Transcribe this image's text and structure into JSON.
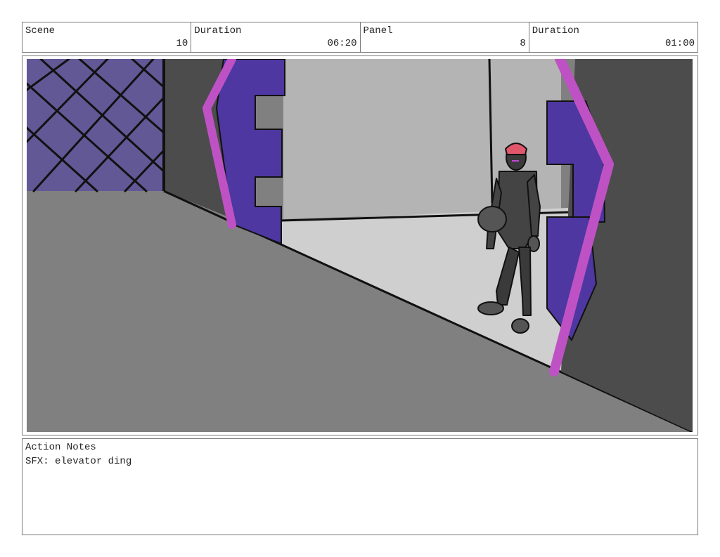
{
  "header": {
    "scene_label": "Scene",
    "scene_value": "10",
    "scene_duration_label": "Duration",
    "scene_duration_value": "06:20",
    "panel_label": "Panel",
    "panel_value": "8",
    "panel_duration_label": "Duration",
    "panel_duration_value": "01:00"
  },
  "notes": {
    "title": "Action Notes",
    "text": "SFX: elevator ding"
  },
  "colors": {
    "door_purple": "#4e37a0",
    "frame_magenta": "#be52c4",
    "window_lavender": "#625896",
    "floor_gray": "#808080",
    "wall_dark": "#4c4c4c",
    "elevator_interior": "#b4b4b4"
  }
}
